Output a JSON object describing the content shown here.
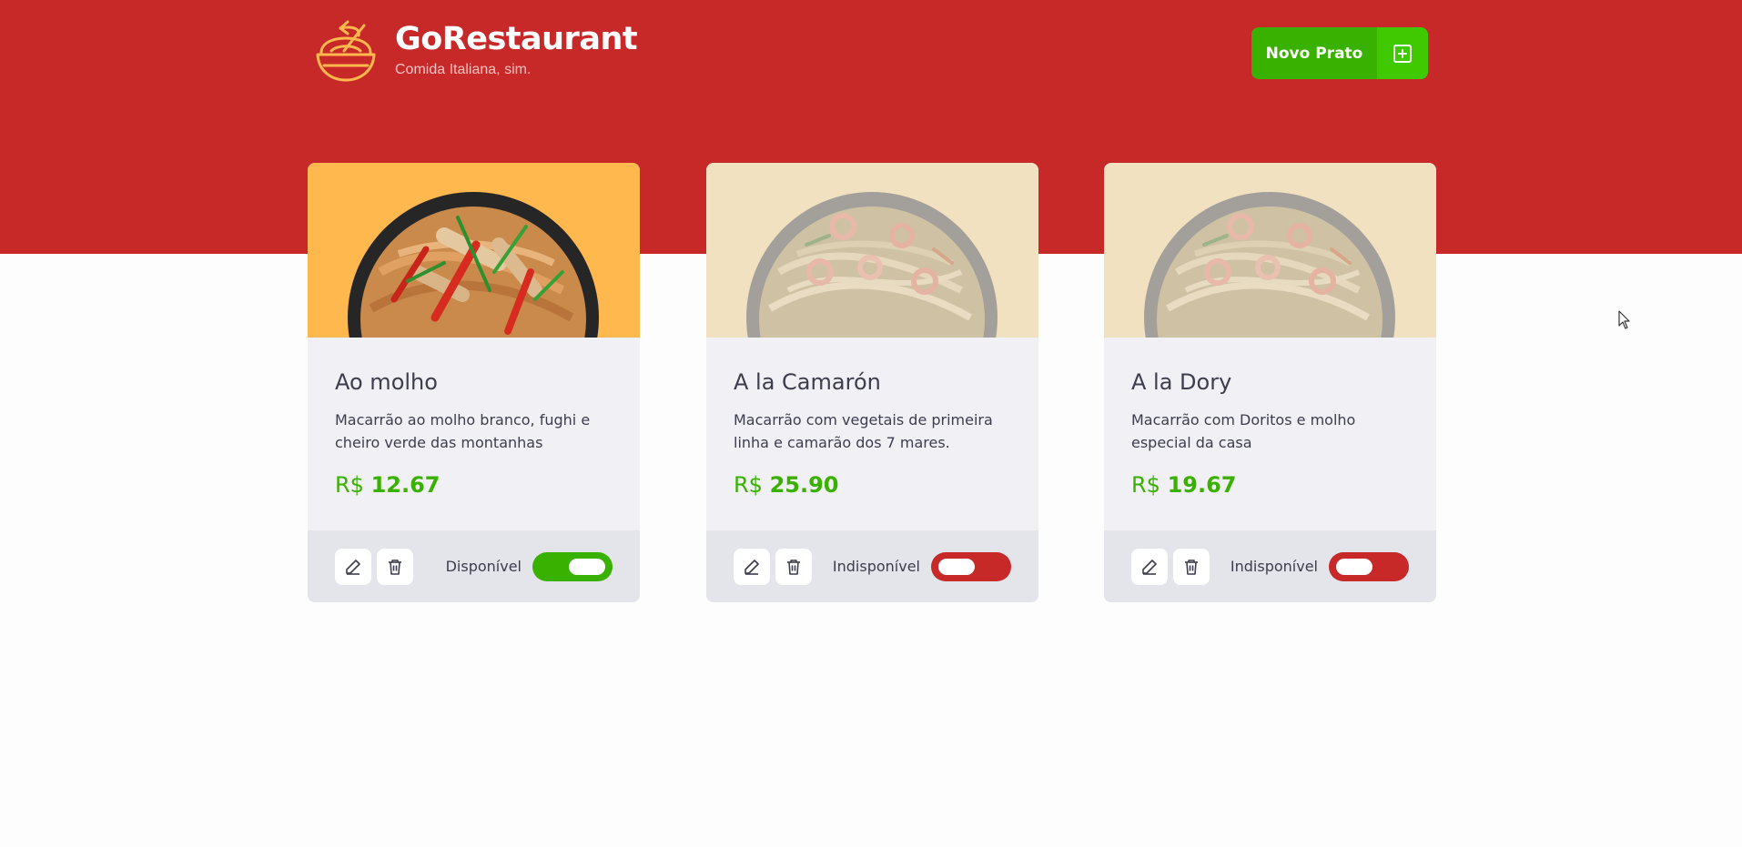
{
  "header": {
    "title": "GoRestaurant",
    "subtitle": "Comida Italiana, sim.",
    "new_dish_label": "Novo Prato",
    "logo_icon": "bowl-icon",
    "add_icon": "plus-square-icon"
  },
  "currency": "R$",
  "colors": {
    "brand_red": "#c72828",
    "available_green": "#39b100",
    "unavailable_red": "#c72828",
    "text_dark": "#3d3d4d"
  },
  "dishes": [
    {
      "name": "Ao molho",
      "description": "Macarrão ao molho branco, fughi e cheiro verde das montanhas",
      "price": "12.67",
      "availability_label": "Disponível",
      "available": true,
      "image_background": "#ffb84d",
      "edit_icon": "pencil-icon",
      "delete_icon": "trash-icon"
    },
    {
      "name": "A la Camarón",
      "description": "Macarrão com vegetais de primeira linha e camarão dos 7 mares.",
      "price": "25.90",
      "availability_label": "Indisponível",
      "available": false,
      "image_background": "#f2e1c1",
      "edit_icon": "pencil-icon",
      "delete_icon": "trash-icon"
    },
    {
      "name": "A la Dory",
      "description": "Macarrão com Doritos e molho especial da casa",
      "price": "19.67",
      "availability_label": "Indisponível",
      "available": false,
      "image_background": "#f2e1c1",
      "edit_icon": "pencil-icon",
      "delete_icon": "trash-icon"
    }
  ]
}
